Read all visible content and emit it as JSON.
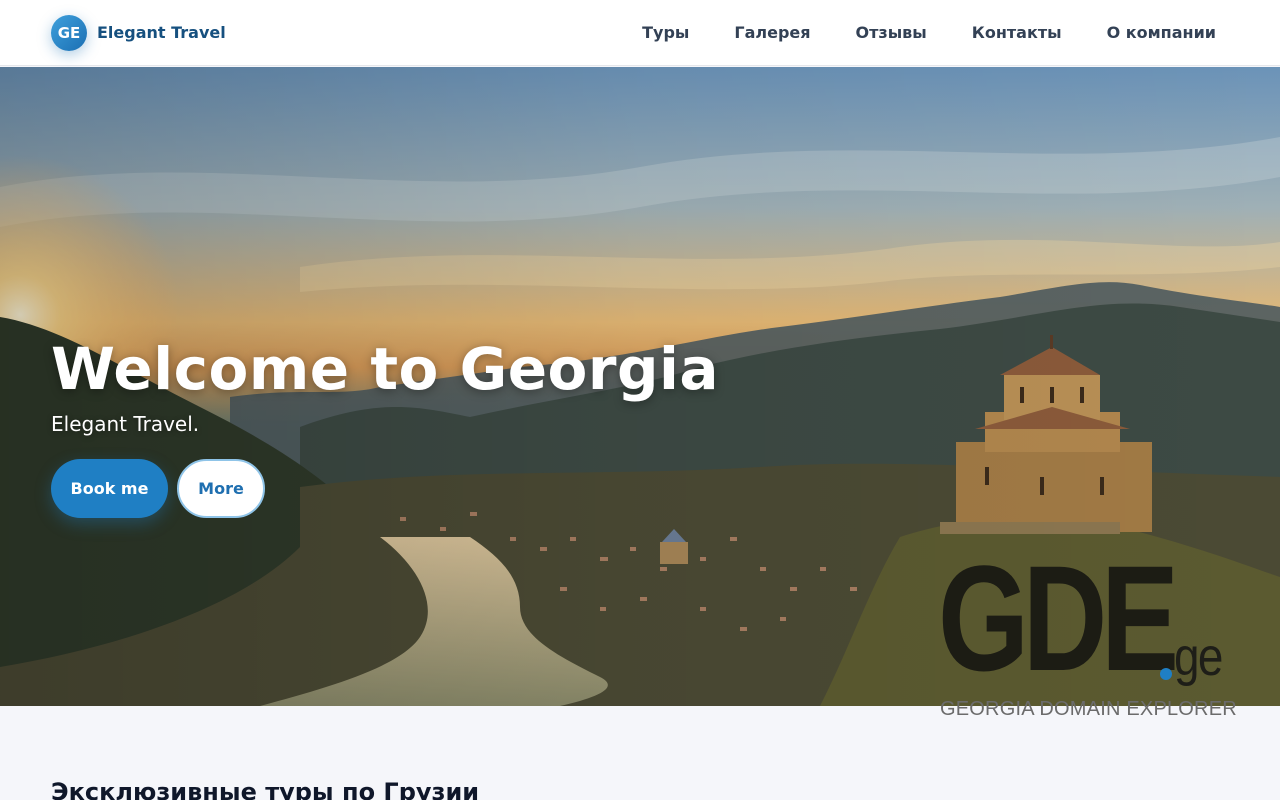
{
  "header": {
    "logo_text": "GE",
    "brand_name": "Elegant Travel",
    "nav": [
      {
        "label": "Туры"
      },
      {
        "label": "Галерея"
      },
      {
        "label": "Отзывы"
      },
      {
        "label": "Контакты"
      },
      {
        "label": "О компании"
      }
    ]
  },
  "hero": {
    "title": "Welcome to Georgia",
    "subtitle": "Elegant Travel.",
    "primary_button": "Book me",
    "secondary_button": "More"
  },
  "watermark": {
    "logo_main": "GDE",
    "logo_suffix": "ge",
    "tagline": "GEORGIA DOMAIN EXPLORER"
  },
  "section": {
    "title": "Эксклюзивные туры по Грузии"
  },
  "colors": {
    "accent": "#1f7fc4",
    "brand_text": "#16507f",
    "nav_text": "#334155"
  }
}
